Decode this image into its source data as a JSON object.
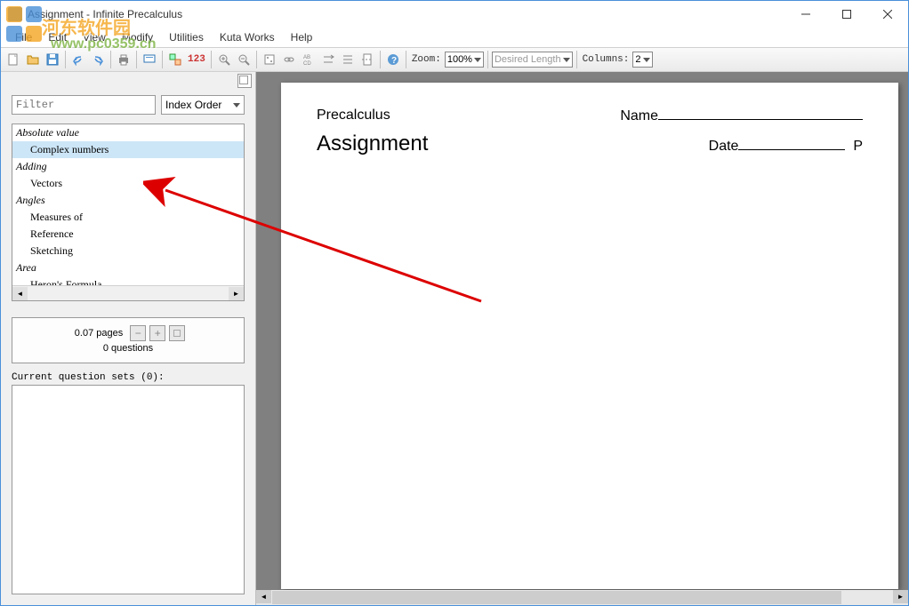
{
  "window": {
    "title": "Assignment - Infinite Precalculus"
  },
  "menu": {
    "file": "File",
    "edit": "Edit",
    "view": "View",
    "modify": "Modify",
    "utilities": "Utilities",
    "kuta_works": "Kuta Works",
    "help": "Help"
  },
  "toolbar": {
    "zoom_label": "Zoom:",
    "zoom_value": "100% ",
    "length_label": "Desired Length",
    "columns_label": "Columns:",
    "columns_value": "2 ",
    "num_123": "123"
  },
  "sidebar": {
    "filter_placeholder": "Filter",
    "sort_label": "Index Order",
    "tree": [
      {
        "type": "cat",
        "label": "Absolute value"
      },
      {
        "type": "item",
        "label": "Complex numbers",
        "selected": true
      },
      {
        "type": "cat",
        "label": "Adding"
      },
      {
        "type": "item",
        "label": "Vectors"
      },
      {
        "type": "cat",
        "label": "Angles"
      },
      {
        "type": "item",
        "label": "Measures of"
      },
      {
        "type": "item",
        "label": "Reference"
      },
      {
        "type": "item",
        "label": "Sketching"
      },
      {
        "type": "cat",
        "label": "Area"
      },
      {
        "type": "item",
        "label": "Heron's Formula"
      }
    ],
    "stats": {
      "pages": "0.07 pages",
      "questions": "0 questions",
      "minus": "−",
      "plus": "+"
    },
    "qset_label": "Current question sets (0):"
  },
  "document": {
    "subject": "Precalculus",
    "name_label": "Name",
    "title": "Assignment",
    "date_label": "Date",
    "period_label": "P"
  },
  "watermark": {
    "text1": "河东软件园",
    "text2": "www.pc0359.cn"
  }
}
